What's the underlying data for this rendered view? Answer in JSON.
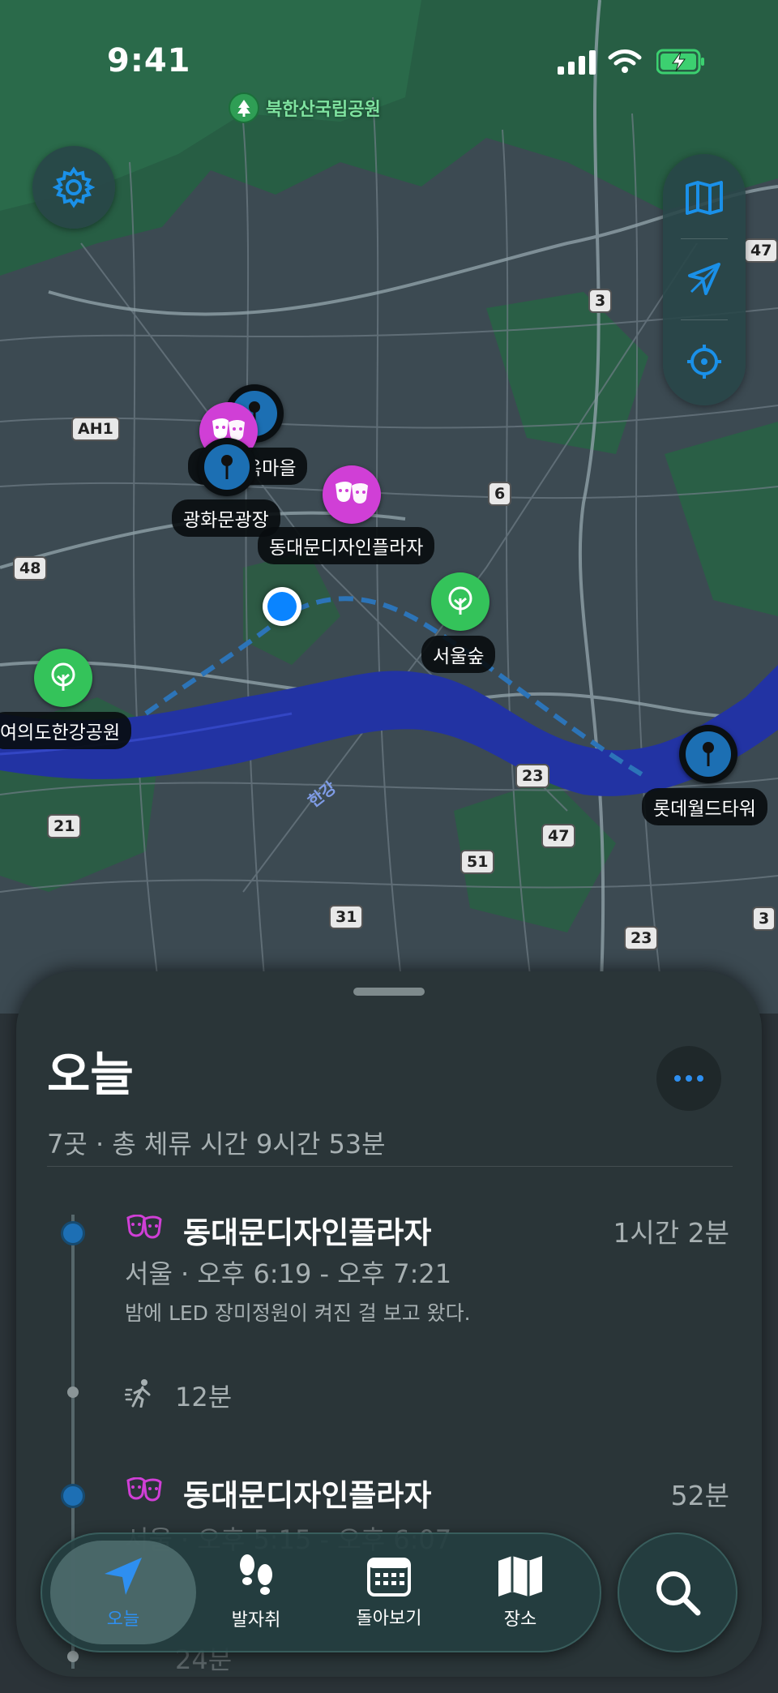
{
  "status_bar": {
    "time": "9:41"
  },
  "map": {
    "park_label": "북한산국립공원",
    "pins": [
      {
        "label": "광화문광장"
      },
      {
        "label": "옥마을"
      },
      {
        "label": "동대문디자인플라자"
      },
      {
        "label": "서울숲"
      },
      {
        "label": "여의도한강공원"
      },
      {
        "label": "롯데월드타워"
      }
    ],
    "river_label": "한강",
    "road_shields": [
      "47",
      "3",
      "AH1",
      "6",
      "48",
      "23",
      "47",
      "51",
      "21",
      "31",
      "23",
      "3"
    ],
    "icons": {
      "settings": "gear-icon",
      "map_mode": "map-icon",
      "navigate": "navigation-arrow-icon",
      "locate": "crosshair-icon"
    },
    "colors": {
      "pin_blue": "#1c6fb3",
      "pin_magenta": "#d03fd6",
      "pin_green": "#34c35a",
      "user_location": "#0a84ff"
    }
  },
  "sheet": {
    "title": "오늘",
    "summary": "7곳 · 총 체류 시간 9시간 53분",
    "entries": [
      {
        "name": "동대문디자인플라자",
        "duration": "1시간 2분",
        "meta": "서울 · 오후 6:19 - 오후 7:21",
        "note": "밤에 LED 장미정원이 켜진 걸 보고 왔다."
      },
      {
        "name": "동대문디자인플라자",
        "duration": "52분",
        "meta": "서울 · 오후 5:15 - 오후 6:07"
      }
    ],
    "travel": [
      {
        "duration": "12분"
      },
      {
        "duration": "24분"
      }
    ]
  },
  "tabbar": {
    "tabs": [
      {
        "label": "오늘",
        "icon": "location-arrow-icon",
        "active": true
      },
      {
        "label": "발자취",
        "icon": "footprints-icon",
        "active": false
      },
      {
        "label": "돌아보기",
        "icon": "calendar-icon",
        "active": false
      },
      {
        "label": "장소",
        "icon": "map-icon",
        "active": false
      }
    ],
    "search_icon": "search-icon"
  }
}
